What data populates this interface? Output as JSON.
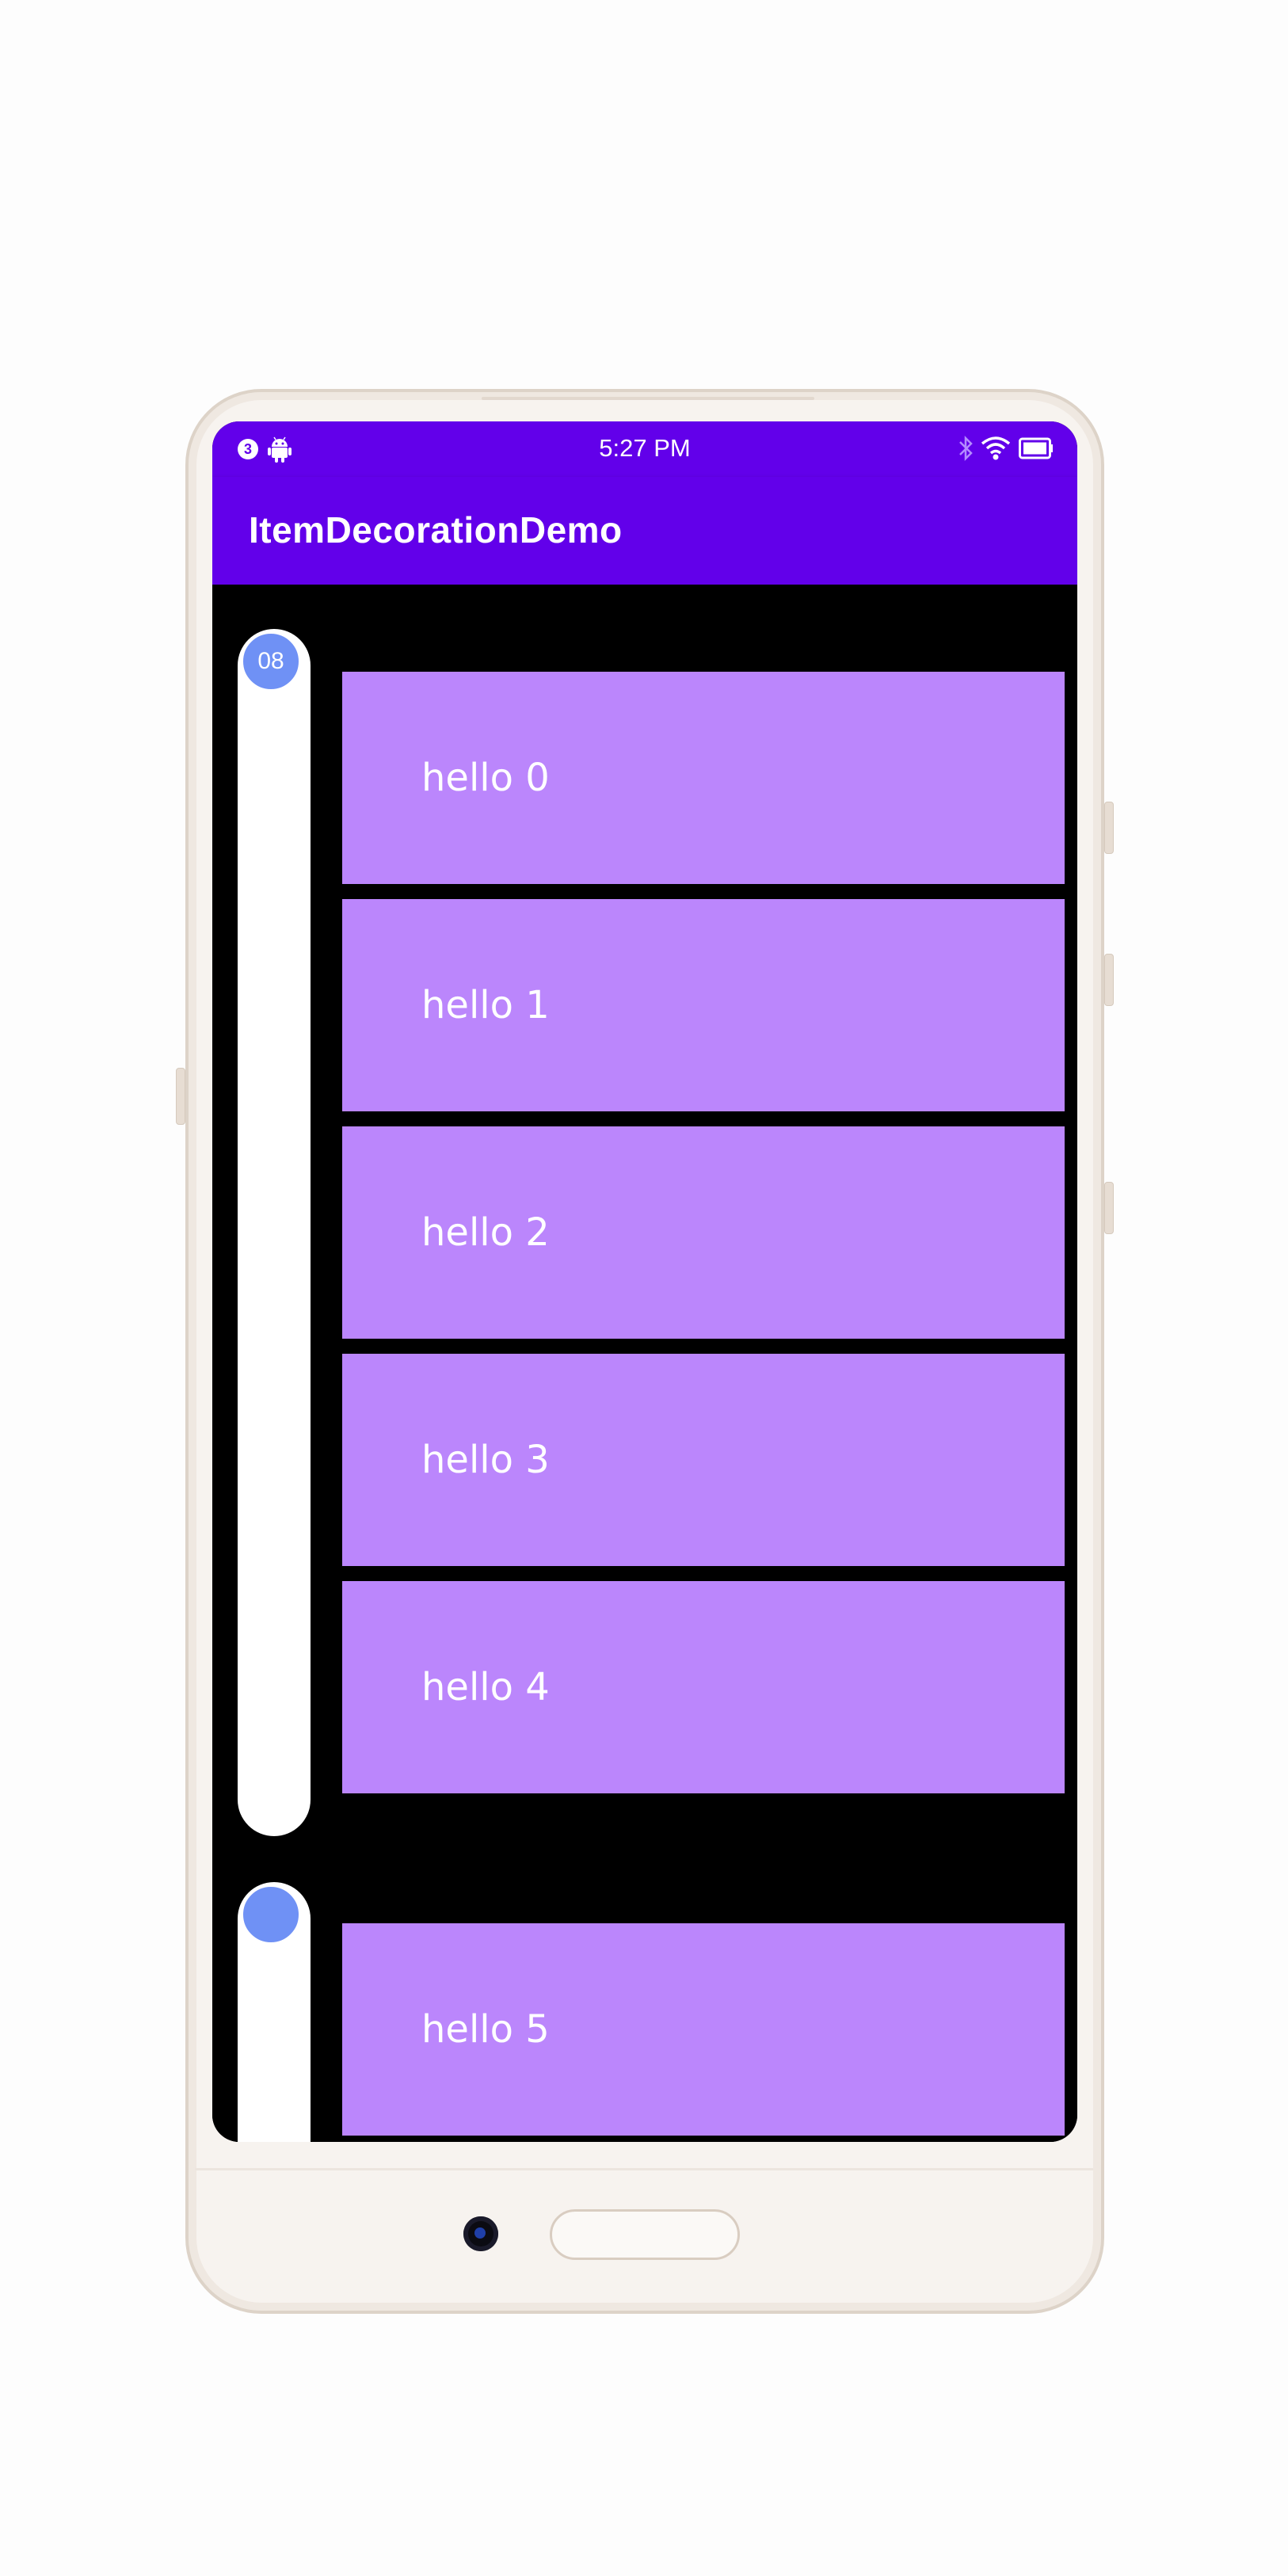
{
  "status_bar": {
    "notification_count": "3",
    "notification_icon": "notification-badge-icon",
    "debug_icon": "android-icon",
    "time": "5:27 PM",
    "icons": [
      "bluetooth-icon",
      "wifi-icon",
      "battery-icon"
    ]
  },
  "app_bar": {
    "title": "ItemDecorationDemo",
    "color": "#6200ea"
  },
  "timeline": {
    "group_label": "08",
    "dot_color": "#6f91f5",
    "track_color": "#ffffff"
  },
  "list": {
    "item_color": "#bb86fc",
    "items": [
      {
        "label": "hello 0"
      },
      {
        "label": "hello 1"
      },
      {
        "label": "hello 2"
      },
      {
        "label": "hello 3"
      },
      {
        "label": "hello 4"
      },
      {
        "label": "hello 5"
      }
    ]
  }
}
